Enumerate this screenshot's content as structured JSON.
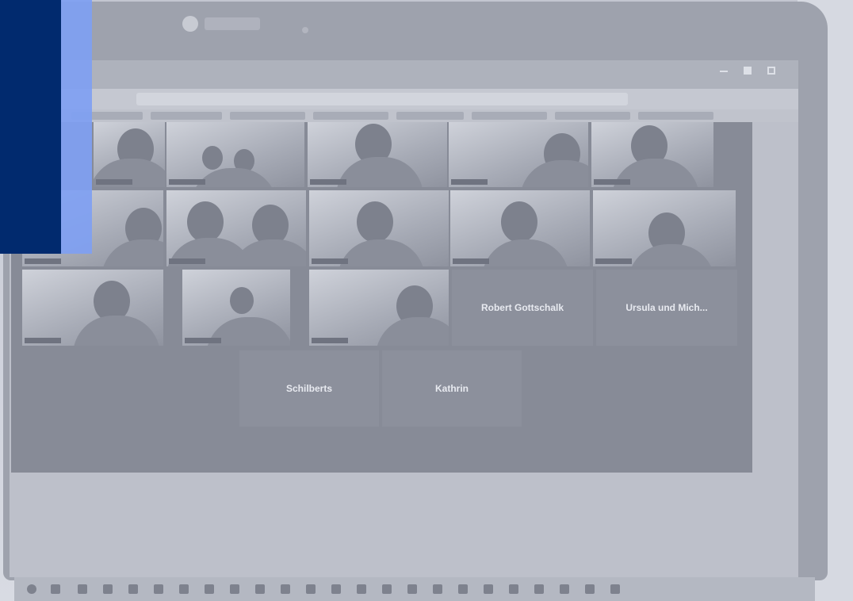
{
  "photo": {
    "subject": "laptop-video-call",
    "overlay_colors": {
      "dark_blue": "#012a6e",
      "light_blue": "#7f9ff2"
    }
  },
  "meeting": {
    "name_tiles": [
      {
        "name": "Robert Gottschalk"
      },
      {
        "name": "Ursula und Mich..."
      },
      {
        "name": "Schilberts"
      },
      {
        "name": "Kathrin"
      }
    ]
  }
}
